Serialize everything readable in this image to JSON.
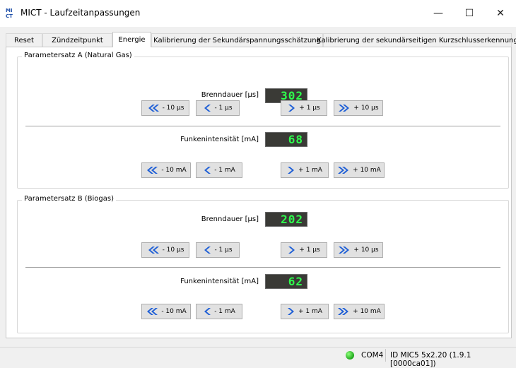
{
  "window": {
    "title": "MICT - Laufzeitanpassungen",
    "minimize": "—",
    "maximize": "☐",
    "close": "✕"
  },
  "tabs": [
    {
      "label": "Reset"
    },
    {
      "label": "Zündzeitpunkt"
    },
    {
      "label": "Energie",
      "active": true
    },
    {
      "label": "Kalibrierung der Sekundärspannungsschätzung"
    },
    {
      "label": "Kalibrierung der sekundärseitigen Kurzschlusserkennung"
    }
  ],
  "groups": [
    {
      "label": "Parametersatz A (Natural Gas)",
      "burn": {
        "label": "Brenndauer [µs]",
        "value": "302",
        "buttons": [
          "- 10 µs",
          "- 1 µs",
          "+ 1 µs",
          "+ 10 µs"
        ]
      },
      "spark": {
        "label": "Funkenintensität [mA]",
        "value": "68",
        "buttons": [
          "- 10 mA",
          "- 1 mA",
          "+ 1 mA",
          "+ 10 mA"
        ]
      }
    },
    {
      "label": "Parametersatz B (Biogas)",
      "burn": {
        "label": "Brenndauer [µs]",
        "value": "202",
        "buttons": [
          "- 10 µs",
          "- 1 µs",
          "+ 1 µs",
          "+ 10 µs"
        ]
      },
      "spark": {
        "label": "Funkenintensität [mA]",
        "value": "62",
        "buttons": [
          "- 10 mA",
          "- 1 mA",
          "+ 1 mA",
          "+ 10 mA"
        ]
      }
    }
  ],
  "status": {
    "port": "COM4",
    "id": "ID MIC5 5x2.20 (1.9.1 [0000ca01])",
    "led_color": "#2fbf2a"
  },
  "icons": {
    "double_left": "double-chevron-left-icon",
    "single_left": "chevron-left-icon",
    "single_right": "chevron-right-icon",
    "double_right": "double-chevron-right-icon"
  },
  "colors": {
    "lcd_text": "#2eff4c",
    "lcd_bg": "#3a3a36",
    "button_icon": "#1f5fd6"
  }
}
